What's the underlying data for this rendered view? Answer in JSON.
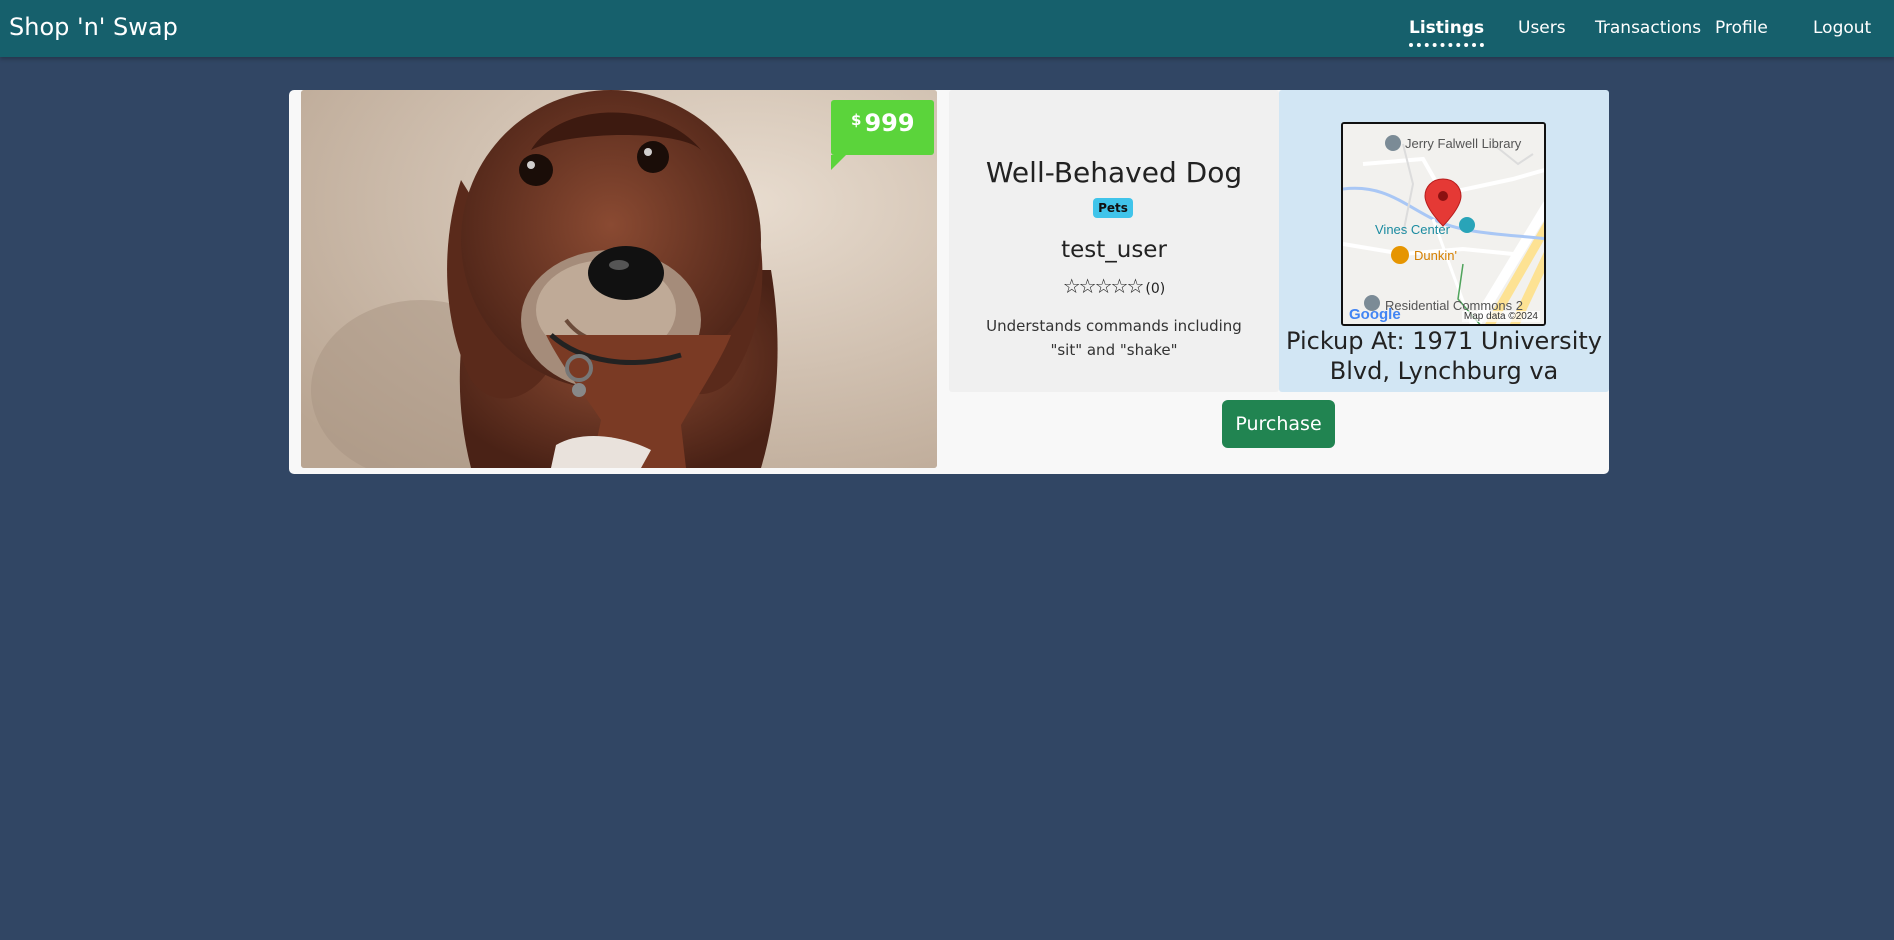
{
  "navbar": {
    "brand": "Shop 'n' Swap",
    "links": [
      {
        "label": "Listings",
        "active": true
      },
      {
        "label": "Users",
        "active": false
      },
      {
        "label": "Transactions",
        "active": false
      },
      {
        "label": "Profile",
        "active": false
      },
      {
        "label": "Logout",
        "active": false
      }
    ],
    "background_color": "#16606c"
  },
  "listing": {
    "price_currency": "$",
    "price": "999",
    "title": "Well-Behaved Dog",
    "category": "Pets",
    "seller": "test_user",
    "rating_stars": "☆☆☆☆☆",
    "rating_count": "(0)",
    "description": "Understands commands including \"sit\" and \"shake\"",
    "image_icon": "dog-photo"
  },
  "map": {
    "labels": {
      "library": "Jerry Falwell Library",
      "vines": "Vines Center",
      "dunkin": "Dunkin'",
      "residential": "Residential Commons 2"
    },
    "google": "Google",
    "attribution": "Map data ©2024"
  },
  "pickup": {
    "text": "Pickup At: 1971 University Blvd, Lynchburg va"
  },
  "actions": {
    "purchase_label": "Purchase"
  },
  "colors": {
    "page_background": "#314664",
    "price_tag": "#5bd43b",
    "category_badge": "#40c4ea",
    "purchase_button": "#218451",
    "pickup_panel": "#d2e6f4"
  }
}
